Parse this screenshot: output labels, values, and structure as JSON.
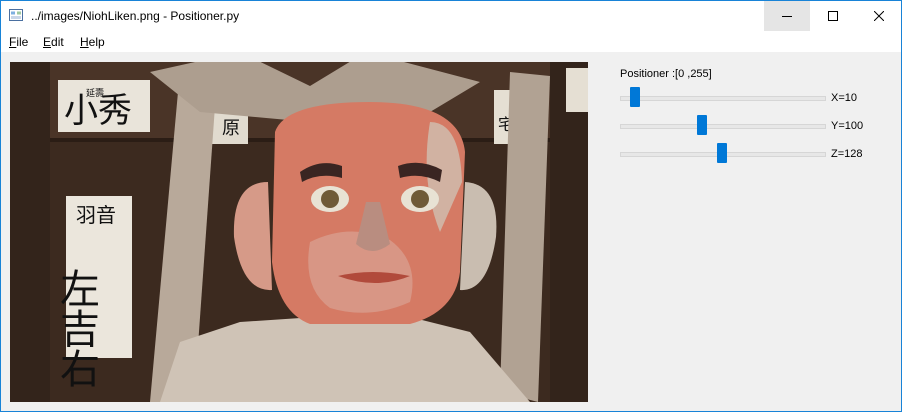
{
  "window": {
    "title": "../images/NiohLiken.png - Positioner.py"
  },
  "menu": {
    "items": [
      {
        "label": "File",
        "mnemonic": "F",
        "rest": "ile"
      },
      {
        "label": "Edit",
        "mnemonic": "E",
        "rest": "dit"
      },
      {
        "label": "Help",
        "mnemonic": "H",
        "rest": "elp"
      }
    ]
  },
  "image": {
    "description_icon": "image-icon",
    "signs": {
      "left_top": "小秀",
      "left_top_small": "延壽",
      "left_main_small": "羽音",
      "left_main": "左吉右",
      "center_small": "原",
      "right_small": "宅"
    }
  },
  "positioner": {
    "title": "Positioner :[0 ,255]",
    "min": 0,
    "max": 255,
    "sliders": [
      {
        "axis": "X",
        "value": 10,
        "label": "X=10"
      },
      {
        "axis": "Y",
        "value": 100,
        "label": "Y=100"
      },
      {
        "axis": "Z",
        "value": 128,
        "label": "Z=128"
      }
    ]
  },
  "colors": {
    "accent": "#0078d7",
    "window_border": "#1883d7",
    "panel_bg": "#f0f0f0"
  }
}
